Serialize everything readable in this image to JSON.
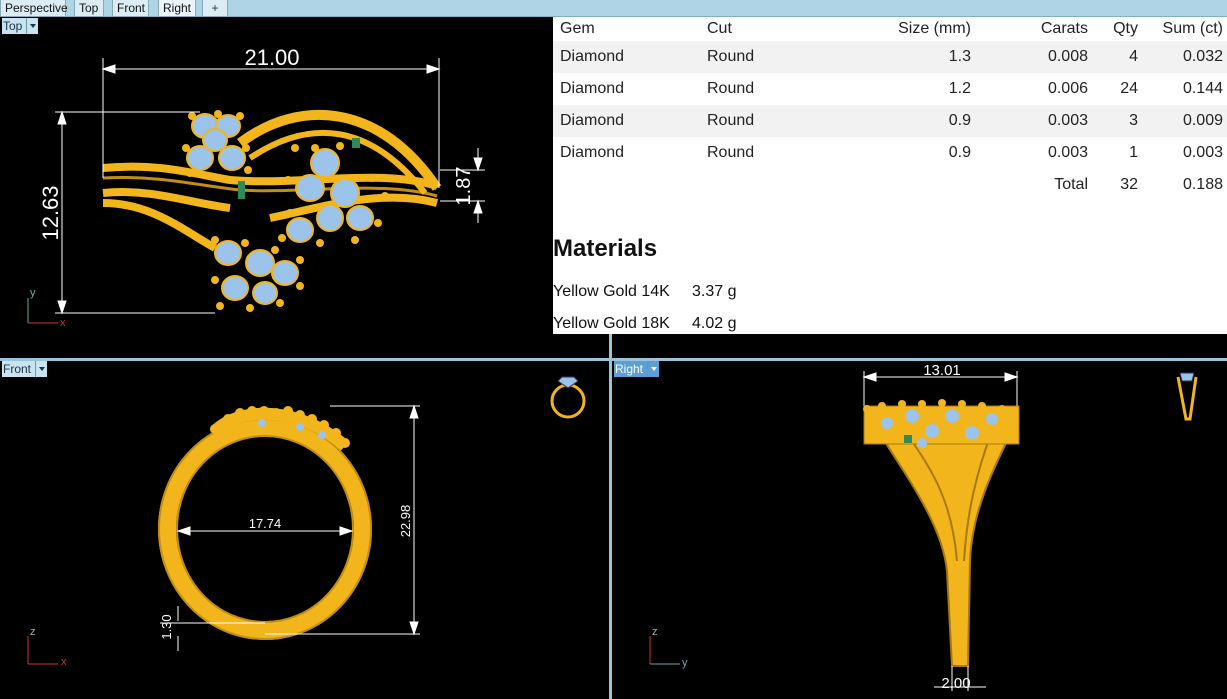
{
  "tabs": [
    {
      "label": "Perspective",
      "active": false
    },
    {
      "label": "Top",
      "active": false
    },
    {
      "label": "Front",
      "active": false
    },
    {
      "label": "Right",
      "active": true
    }
  ],
  "tab_add_glyph": "+",
  "viewports": {
    "top": {
      "label": "Top",
      "dims": {
        "width": "21.00",
        "height": "12.63",
        "band": "1.87"
      },
      "axis_x": "x",
      "axis_y": "y"
    },
    "front": {
      "label": "Front",
      "dims": {
        "inner": "17.74",
        "height": "22.98",
        "band": "1.30"
      },
      "axis_x": "x",
      "axis_y": "z"
    },
    "right": {
      "label": "Right",
      "dims": {
        "width": "13.01",
        "shank": "2.00"
      },
      "axis_x": "y",
      "axis_y": "z"
    }
  },
  "gem_table": {
    "headers": {
      "gem": "Gem",
      "cut": "Cut",
      "size": "Size (mm)",
      "carats": "Carats",
      "qty": "Qty",
      "sum": "Sum (ct)"
    },
    "rows": [
      {
        "gem": "Diamond",
        "cut": "Round",
        "size": "1.3",
        "carats": "0.008",
        "qty": "4",
        "sum": "0.032"
      },
      {
        "gem": "Diamond",
        "cut": "Round",
        "size": "1.2",
        "carats": "0.006",
        "qty": "24",
        "sum": "0.144"
      },
      {
        "gem": "Diamond",
        "cut": "Round",
        "size": "0.9",
        "carats": "0.003",
        "qty": "3",
        "sum": "0.009"
      },
      {
        "gem": "Diamond",
        "cut": "Round",
        "size": "0.9",
        "carats": "0.003",
        "qty": "1",
        "sum": "0.003"
      }
    ],
    "total": {
      "label": "Total",
      "qty": "32",
      "sum": "0.188"
    }
  },
  "materials": {
    "title": "Materials",
    "items": [
      {
        "name": "Yellow Gold 14K",
        "weight": "3.37 g"
      },
      {
        "name": "Yellow Gold 18K",
        "weight": "4.02 g"
      }
    ]
  },
  "colors": {
    "gold": "#f2b51c",
    "gold_dark": "#a8780a",
    "diamond": "#9cc3ea",
    "emerald": "#2e8b57",
    "dimension": "#ffffff",
    "viewport_bg": "#000000",
    "active_label": "#5b9fd6"
  },
  "icons": {
    "front_preview": "ring-front-icon",
    "right_preview": "ring-side-icon",
    "add_tab": "plus-icon"
  }
}
